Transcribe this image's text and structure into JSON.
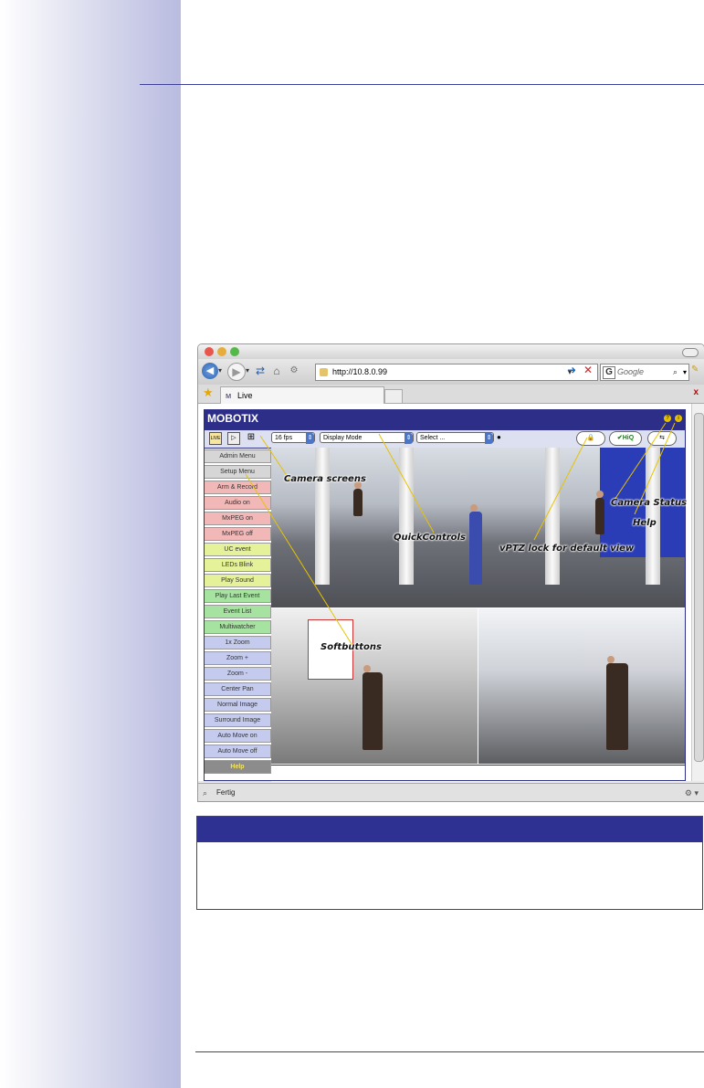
{
  "browser": {
    "url": "http://10.8.0.99",
    "search_placeholder": "Google",
    "tab_label": "Live",
    "close_glyph": "x",
    "status_text": "Fertig"
  },
  "mobotix": {
    "logo": "MOBOTIX",
    "fps": "16 fps",
    "display_mode": "Display Mode",
    "select": "Select ...",
    "hiq_label": "✔HiQ",
    "softbuttons": [
      {
        "label": "Admin Menu",
        "color": "#d6d6d6"
      },
      {
        "label": "Setup Menu",
        "color": "#d6d6d6"
      },
      {
        "label": "Arm & Record",
        "color": "#f2b8b8"
      },
      {
        "label": "Audio on",
        "color": "#f2b8b8"
      },
      {
        "label": "MxPEG on",
        "color": "#f2b8b8"
      },
      {
        "label": "MxPEG off",
        "color": "#f2b8b8"
      },
      {
        "label": "UC event",
        "color": "#e6f29a"
      },
      {
        "label": "LEDs Blink",
        "color": "#e6f29a"
      },
      {
        "label": "Play Sound",
        "color": "#e6f29a"
      },
      {
        "label": "Play Last Event",
        "color": "#a6e3a0"
      },
      {
        "label": "Event List",
        "color": "#a6e3a0"
      },
      {
        "label": "Multiwatcher",
        "color": "#a6e3a0"
      },
      {
        "label": "1x Zoom",
        "color": "#c4cbee"
      },
      {
        "label": "Zoom +",
        "color": "#c4cbee"
      },
      {
        "label": "Zoom -",
        "color": "#c4cbee"
      },
      {
        "label": "Center Pan",
        "color": "#c4cbee"
      },
      {
        "label": "Normal Image",
        "color": "#c4cbee"
      },
      {
        "label": "Surround Image",
        "color": "#c4cbee"
      },
      {
        "label": "Auto Move on",
        "color": "#c4cbee"
      },
      {
        "label": "Auto Move off",
        "color": "#c4cbee"
      },
      {
        "label": "Help",
        "color": "#8c8c8c"
      }
    ]
  },
  "annotations": {
    "camera_screens": "Camera screens",
    "quick_controls": "QuickControls",
    "vptz_lock": "vPTZ lock for default view",
    "camera_status": "Camera Status",
    "help": "Help",
    "softbuttons": "Softbuttons"
  },
  "colors": {
    "brand": "#2c2e88",
    "annotation_line": "#e6c300"
  }
}
